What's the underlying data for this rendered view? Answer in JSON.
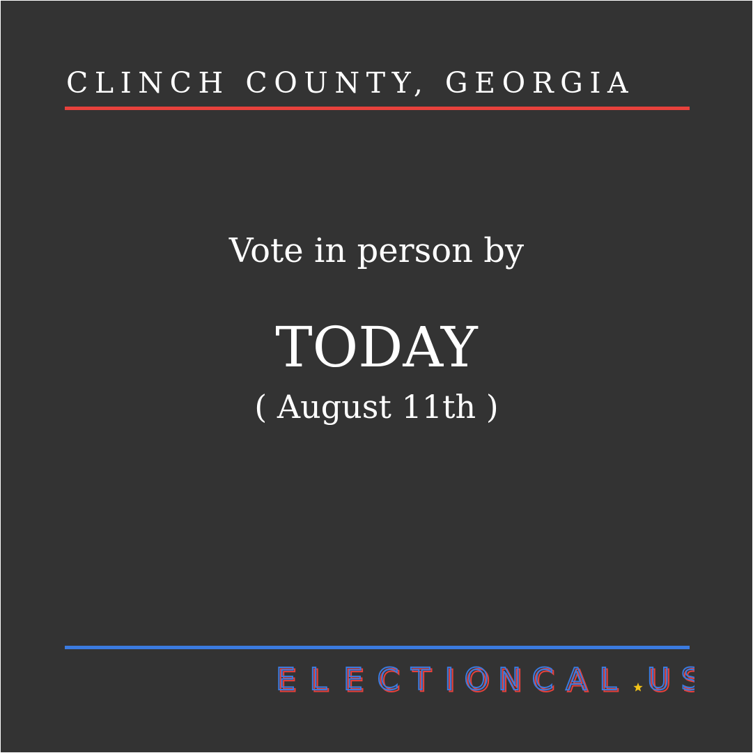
{
  "region_title": "CLINCH COUNTY, GEORGIA",
  "lead_text": "Vote in person by",
  "deadline": "TODAY",
  "date_text": "( August 11th )",
  "brand": {
    "name": "ELECTIONCAL",
    "separator_icon": "star-icon",
    "suffix": "US"
  },
  "colors": {
    "background": "#333333",
    "text": "#ffffff",
    "red": "#e8413c",
    "blue": "#3b7be0",
    "star": "#f2c318"
  }
}
